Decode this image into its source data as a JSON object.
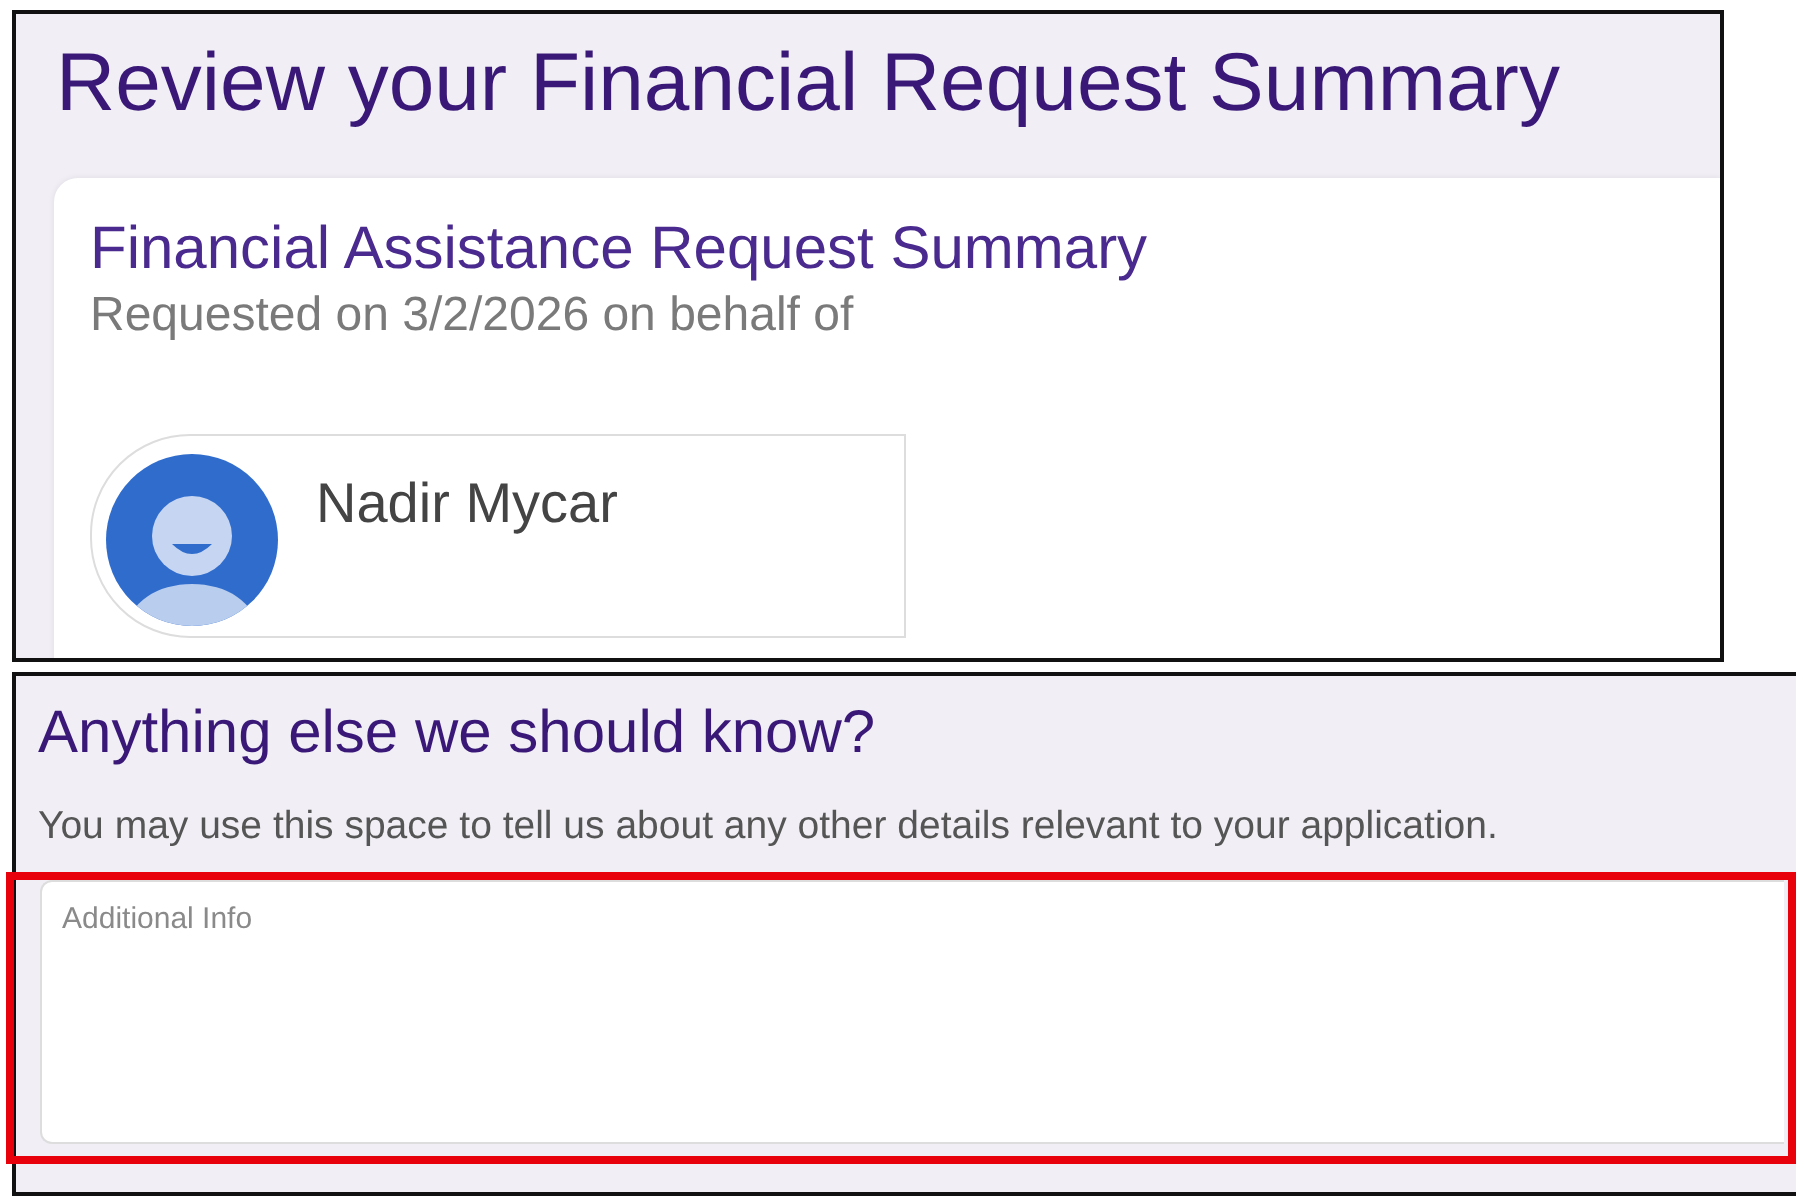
{
  "summary_panel": {
    "title": "Review your Financial Request Summary",
    "card": {
      "title": "Financial Assistance Request Summary",
      "subtitle": "Requested on 3/2/2026 on behalf of",
      "person": {
        "name": "Nadir Mycar"
      }
    }
  },
  "details_panel": {
    "title": "Anything else we should know?",
    "description": "You may use this space to tell us about any other details relevant to your application.",
    "field": {
      "placeholder": "Additional Info",
      "highlighted": true
    }
  }
}
